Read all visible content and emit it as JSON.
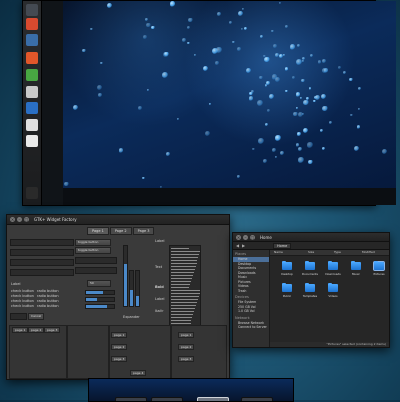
{
  "desktop": {
    "launcher_icons": [
      "gear-icon",
      "chrome-icon",
      "shield-icon",
      "ubuntu-icon",
      "download-icon",
      "text-editor-icon",
      "terminal-icon",
      "settings-icon",
      "document-icon",
      "trash-icon"
    ],
    "launcher_colors": [
      "#444a52",
      "#d84a2f",
      "#3a6ea8",
      "#e2572a",
      "#48a742",
      "#c9c9c9",
      "#2a6fc4",
      "#e0e0e0",
      "#eaeaea",
      "#2a2a2a"
    ]
  },
  "widget_factory": {
    "title": "GTK+ Widget Factory",
    "tabs": [
      "Page 1",
      "Page 2",
      "Page 3"
    ],
    "buttons": [
      "toggle button",
      "toggle button",
      "Cancel"
    ],
    "labels": {
      "l1": "Label",
      "l2": "Label",
      "l3": "Text",
      "l4": "Bold",
      "l5": "Label",
      "l6": "Italic",
      "l7": "Underlined",
      "l8": "Expander"
    },
    "radios": [
      "radio button",
      "radio button",
      "radio button",
      "radio button"
    ],
    "checks": [
      "check button",
      "check button",
      "check button",
      "check button"
    ],
    "pages_bottom": [
      "page 1",
      "page 2",
      "page 3"
    ],
    "pages_right": [
      "page 1",
      "page 2",
      "page 3",
      "page 4"
    ],
    "spin_value": "50",
    "slider_levels": [
      0.7,
      0.45,
      0.3
    ]
  },
  "file_manager": {
    "title": "Home",
    "toolbar_path": "Home",
    "sidebar": {
      "places_header": "Places",
      "places": [
        "Home",
        "Desktop",
        "Documents",
        "Downloads",
        "Music",
        "Pictures",
        "Videos",
        "Trash"
      ],
      "devices_header": "Devices",
      "devices": [
        "File System",
        "250 GB Vol",
        "1.0 GB Vol"
      ],
      "network_header": "Network",
      "network": [
        "Browse Network",
        "Connect to Server"
      ]
    },
    "columns": [
      "Name",
      "Size",
      "Type",
      "Modified"
    ],
    "folders": [
      "Desktop",
      "Documents",
      "Downloads",
      "Music",
      "Pictures",
      "Public",
      "Templates",
      "Videos"
    ],
    "status": "\"Pictures\" selected (containing 2 items)"
  }
}
